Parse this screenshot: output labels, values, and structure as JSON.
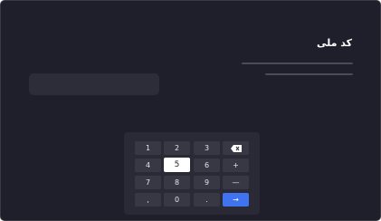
{
  "header": {
    "title": "کد ملی"
  },
  "keypad": {
    "keys": [
      "1",
      "2",
      "3",
      "4",
      "5",
      "6",
      "+",
      "7",
      "8",
      "9",
      "—",
      ",",
      "0",
      ".",
      "→"
    ],
    "active_key": "5",
    "icons": {
      "backspace": "backspace-icon",
      "enter": "arrow-right-icon"
    },
    "colors": {
      "active": "#ffffff",
      "enter": "#3f73ef",
      "key": "#383845",
      "background": "#1f1f2b"
    }
  }
}
